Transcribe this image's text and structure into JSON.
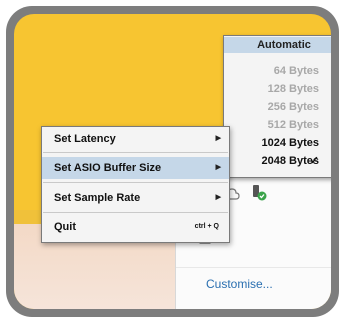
{
  "context_menu": {
    "items": [
      {
        "label": "Set Latency",
        "has_submenu": true,
        "highlighted": false
      },
      {
        "label": "Set ASIO Buffer Size",
        "has_submenu": true,
        "highlighted": true
      },
      {
        "label": "Set Sample Rate",
        "has_submenu": true,
        "highlighted": false
      },
      {
        "label": "Quit",
        "shortcut": "ctrl + Q",
        "has_submenu": false,
        "highlighted": false
      }
    ]
  },
  "buffer_submenu": {
    "items": [
      {
        "label": "Automatic",
        "enabled": true,
        "checked": false
      },
      {
        "label": "64 Bytes",
        "enabled": false,
        "checked": false
      },
      {
        "label": "128 Bytes",
        "enabled": false,
        "checked": false
      },
      {
        "label": "256 Bytes",
        "enabled": false,
        "checked": false
      },
      {
        "label": "512 Bytes",
        "enabled": false,
        "checked": false
      },
      {
        "label": "1024 Bytes",
        "enabled": true,
        "checked": false
      },
      {
        "label": "2048 Bytes",
        "enabled": true,
        "checked": true
      }
    ],
    "check_mark": "✓"
  },
  "tray": {
    "customise_label": "Customise..."
  },
  "colors": {
    "highlight": "#c5d7e8",
    "background_yellow": "#f7c531",
    "link_blue": "#2a6fb0"
  }
}
